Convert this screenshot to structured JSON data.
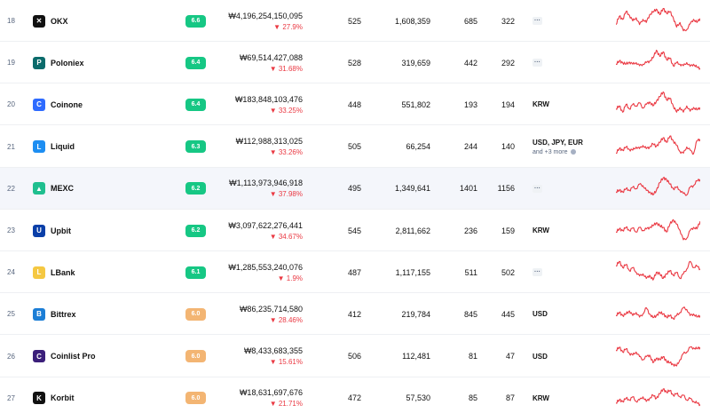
{
  "colors": {
    "score_green": "#16c784",
    "score_orange": "#f3b573",
    "negative": "#ea3943",
    "sparkline": "#ea3943"
  },
  "rows": [
    {
      "rank": "18",
      "name": "OKX",
      "score": "6.6",
      "score_color": "green",
      "volume": "₩4,196,254,150,095",
      "change": "27.9%",
      "c1": "525",
      "c2": "1,608,359",
      "c3": "685",
      "c4": "322",
      "fiat": "",
      "fiat_more": "",
      "logo_icon": "okx-logo-icon",
      "logo_color": "#111111",
      "logo_glyph": "✕",
      "spark": [
        0.62,
        0.35,
        0.45,
        0.2,
        0.32,
        0.5,
        0.4,
        0.62,
        0.45,
        0.55,
        0.3,
        0.22,
        0.12,
        0.3,
        0.1,
        0.25,
        0.2,
        0.4,
        0.7,
        0.55,
        0.82,
        0.78,
        0.6,
        0.45,
        0.55,
        0.42
      ]
    },
    {
      "rank": "19",
      "name": "Poloniex",
      "score": "6.4",
      "score_color": "green",
      "volume": "₩69,514,427,088",
      "change": "31.68%",
      "c1": "528",
      "c2": "319,659",
      "c3": "442",
      "c4": "292",
      "fiat": "",
      "fiat_more": "",
      "logo_icon": "poloniex-logo-icon",
      "logo_color": "#0b6b6b",
      "logo_glyph": "P",
      "spark": [
        0.55,
        0.45,
        0.5,
        0.55,
        0.48,
        0.55,
        0.5,
        0.6,
        0.55,
        0.5,
        0.45,
        0.35,
        0.1,
        0.3,
        0.15,
        0.4,
        0.35,
        0.6,
        0.5,
        0.55,
        0.6,
        0.5,
        0.62,
        0.55,
        0.65,
        0.68
      ]
    },
    {
      "rank": "20",
      "name": "Coinone",
      "score": "6.4",
      "score_color": "green",
      "volume": "₩183,848,103,476",
      "change": "33.25%",
      "c1": "448",
      "c2": "551,802",
      "c3": "193",
      "c4": "194",
      "fiat": "KRW",
      "fiat_more": "",
      "logo_icon": "coinone-logo-icon",
      "logo_color": "#2e6bff",
      "logo_glyph": "C",
      "spark": [
        0.65,
        0.55,
        0.75,
        0.5,
        0.65,
        0.5,
        0.55,
        0.45,
        0.62,
        0.5,
        0.42,
        0.55,
        0.4,
        0.25,
        0.1,
        0.35,
        0.3,
        0.55,
        0.75,
        0.6,
        0.75,
        0.55,
        0.72,
        0.6,
        0.68,
        0.6
      ]
    },
    {
      "rank": "21",
      "name": "Liquid",
      "score": "6.3",
      "score_color": "green",
      "volume": "₩112,988,313,025",
      "change": "33.26%",
      "c1": "505",
      "c2": "66,254",
      "c3": "244",
      "c4": "140",
      "fiat": "USD, JPY, EUR",
      "fiat_more": "and +3 more",
      "logo_icon": "liquid-logo-icon",
      "logo_color": "#1d8ef2",
      "logo_glyph": "L",
      "spark": [
        0.7,
        0.55,
        0.6,
        0.5,
        0.58,
        0.6,
        0.5,
        0.55,
        0.45,
        0.55,
        0.5,
        0.4,
        0.48,
        0.35,
        0.2,
        0.35,
        0.15,
        0.3,
        0.45,
        0.65,
        0.7,
        0.5,
        0.6,
        0.72,
        0.3,
        0.25
      ]
    },
    {
      "rank": "22",
      "name": "MEXC",
      "score": "6.2",
      "score_color": "green",
      "volume": "₩1,113,973,946,918",
      "change": "37.98%",
      "c1": "495",
      "c2": "1,349,641",
      "c3": "1401",
      "c4": "1156",
      "fiat": "",
      "fiat_more": "",
      "logo_icon": "mexc-logo-icon",
      "logo_color": "#1fbf8f",
      "logo_glyph": "▲",
      "spark": [
        0.6,
        0.55,
        0.6,
        0.5,
        0.55,
        0.45,
        0.5,
        0.35,
        0.4,
        0.55,
        0.6,
        0.7,
        0.55,
        0.3,
        0.15,
        0.2,
        0.35,
        0.5,
        0.45,
        0.55,
        0.65,
        0.7,
        0.45,
        0.4,
        0.25,
        0.2
      ]
    },
    {
      "rank": "23",
      "name": "Upbit",
      "score": "6.2",
      "score_color": "green",
      "volume": "₩3,097,622,276,441",
      "change": "34.67%",
      "c1": "545",
      "c2": "2,811,662",
      "c3": "236",
      "c4": "159",
      "fiat": "KRW",
      "fiat_more": "",
      "logo_icon": "upbit-logo-icon",
      "logo_color": "#0a3fa8",
      "logo_glyph": "U",
      "spark": [
        0.55,
        0.45,
        0.5,
        0.4,
        0.5,
        0.42,
        0.55,
        0.4,
        0.5,
        0.45,
        0.4,
        0.35,
        0.25,
        0.35,
        0.4,
        0.55,
        0.3,
        0.15,
        0.3,
        0.5,
        0.8,
        0.75,
        0.5,
        0.4,
        0.45,
        0.2
      ]
    },
    {
      "rank": "24",
      "name": "LBank",
      "score": "6.1",
      "score_color": "green",
      "volume": "₩1,285,553,240,076",
      "change": "1.9%",
      "c1": "487",
      "c2": "1,117,155",
      "c3": "511",
      "c4": "502",
      "fiat": "",
      "fiat_more": "",
      "logo_icon": "lbank-logo-icon",
      "logo_color": "#f5c842",
      "logo_glyph": "L",
      "spark": [
        0.3,
        0.15,
        0.35,
        0.25,
        0.45,
        0.35,
        0.5,
        0.62,
        0.55,
        0.7,
        0.6,
        0.75,
        0.5,
        0.55,
        0.7,
        0.55,
        0.45,
        0.6,
        0.5,
        0.7,
        0.55,
        0.4,
        0.15,
        0.35,
        0.3,
        0.4
      ]
    },
    {
      "rank": "25",
      "name": "Bittrex",
      "score": "6.0",
      "score_color": "orange",
      "volume": "₩86,235,714,580",
      "change": "28.46%",
      "c1": "412",
      "c2": "219,784",
      "c3": "845",
      "c4": "445",
      "fiat": "USD",
      "fiat_more": "",
      "logo_icon": "bittrex-logo-icon",
      "logo_color": "#1c7ed6",
      "logo_glyph": "B",
      "spark": [
        0.55,
        0.45,
        0.55,
        0.5,
        0.4,
        0.55,
        0.45,
        0.6,
        0.5,
        0.3,
        0.5,
        0.62,
        0.55,
        0.45,
        0.5,
        0.6,
        0.55,
        0.65,
        0.55,
        0.45,
        0.3,
        0.35,
        0.55,
        0.5,
        0.6,
        0.55
      ]
    },
    {
      "rank": "26",
      "name": "Coinlist Pro",
      "score": "6.0",
      "score_color": "orange",
      "volume": "₩8,433,683,355",
      "change": "15.61%",
      "c1": "506",
      "c2": "112,481",
      "c3": "81",
      "c4": "47",
      "fiat": "USD",
      "fiat_more": "",
      "logo_icon": "coinlist-logo-icon",
      "logo_color": "#3b1f7a",
      "logo_glyph": "C",
      "spark": [
        0.3,
        0.2,
        0.35,
        0.25,
        0.4,
        0.45,
        0.35,
        0.5,
        0.6,
        0.5,
        0.45,
        0.7,
        0.55,
        0.6,
        0.5,
        0.65,
        0.7,
        0.75,
        0.8,
        0.6,
        0.4,
        0.35,
        0.2,
        0.22,
        0.25,
        0.2
      ]
    },
    {
      "rank": "27",
      "name": "Korbit",
      "score": "6.0",
      "score_color": "orange",
      "volume": "₩18,631,697,676",
      "change": "21.71%",
      "c1": "472",
      "c2": "57,530",
      "c3": "85",
      "c4": "87",
      "fiat": "KRW",
      "fiat_more": "",
      "logo_icon": "korbit-logo-icon",
      "logo_color": "#111111",
      "logo_glyph": "K",
      "spark": [
        0.65,
        0.55,
        0.6,
        0.5,
        0.55,
        0.45,
        0.6,
        0.55,
        0.45,
        0.6,
        0.5,
        0.4,
        0.5,
        0.35,
        0.2,
        0.3,
        0.25,
        0.4,
        0.35,
        0.45,
        0.4,
        0.55,
        0.5,
        0.6,
        0.65,
        0.7
      ]
    }
  ]
}
